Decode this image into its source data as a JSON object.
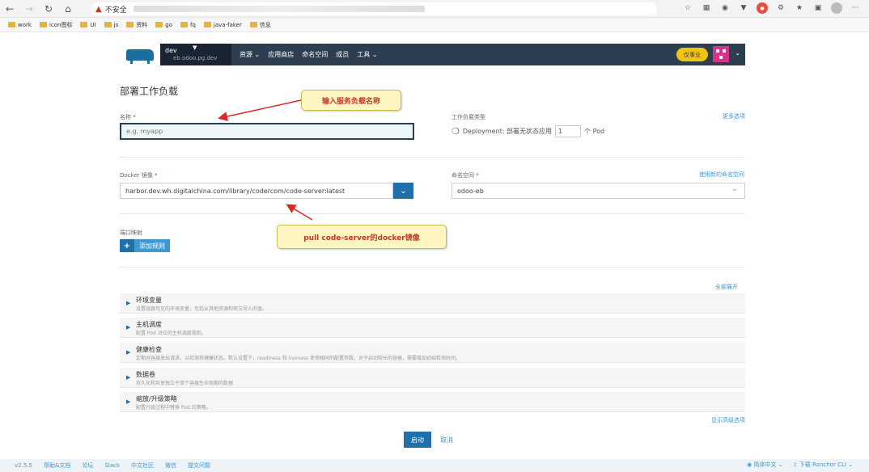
{
  "browser": {
    "insecure_label": "不安全",
    "bookmarks": [
      "work",
      "icon图标",
      "UI",
      "js",
      "资料",
      "go",
      "fq",
      "java-faker",
      "信息"
    ]
  },
  "header": {
    "env_name": "dev",
    "env_sub": "eb.odoo.pg.dev",
    "menu": [
      "资源",
      "应用商店",
      "命名空间",
      "成员",
      "工具"
    ],
    "upgrade": "仅事业"
  },
  "page": {
    "title": "部署工作负载",
    "name_label": "名称",
    "name_placeholder": "e.g. myapp",
    "workload_type_label": "工作负载类型",
    "more_options": "更多选项",
    "workload_desc": "Deployment: 部署无状态应用",
    "pod_count": "1",
    "pod_unit": "个 Pod",
    "docker_image_label": "Docker 镜像",
    "docker_image_value": "harbor.dev.wh.digitalchina.com/library/codercom/code-server:latest",
    "namespace_label": "命名空间",
    "add_namespace_link": "使用新的命名空间",
    "namespace_value": "odoo-eb",
    "port_mapping_label": "端口映射",
    "add_rule": "添加规则",
    "expand_all": "全部展开",
    "show_advanced": "显示高级选项",
    "launch": "启动",
    "cancel": "取消"
  },
  "accordion": [
    {
      "title": "环境变量",
      "desc": "设置容器可见的环境变量，包括从其他资源和密文导入的值。"
    },
    {
      "title": "主机调度",
      "desc": "配置 Pod 对应的主机调度规则。"
    },
    {
      "title": "健康检查",
      "desc": "定期对容器发出请求，以检测其健康状态。默认设置下，readiness 和 liveness 使用相同的配置参数。对于启动较长的容器，需要增加初始检测时间。"
    },
    {
      "title": "数据卷",
      "desc": "持久化和共享独立于单个容器生命周期的数据"
    },
    {
      "title": "缩放/升级策略",
      "desc": "配置升级过程中替换 Pod 的策略。"
    }
  ],
  "callouts": {
    "name": "输入服务负载名称",
    "image": "pull code-server的docker镜像"
  },
  "footer": {
    "version": "v2.5.5",
    "links": [
      "帮助&文档",
      "论坛",
      "Slack",
      "中文社区",
      "微信",
      "提交问题"
    ],
    "language": "简体中文",
    "download": "下载 Ranchor CLI"
  },
  "colors": {
    "header_bg": "#2c3e50",
    "primary": "#1f6fa8",
    "link": "#3d98d3",
    "callout_text": "#c0392b",
    "callout_bg": "#fdf6c3"
  }
}
